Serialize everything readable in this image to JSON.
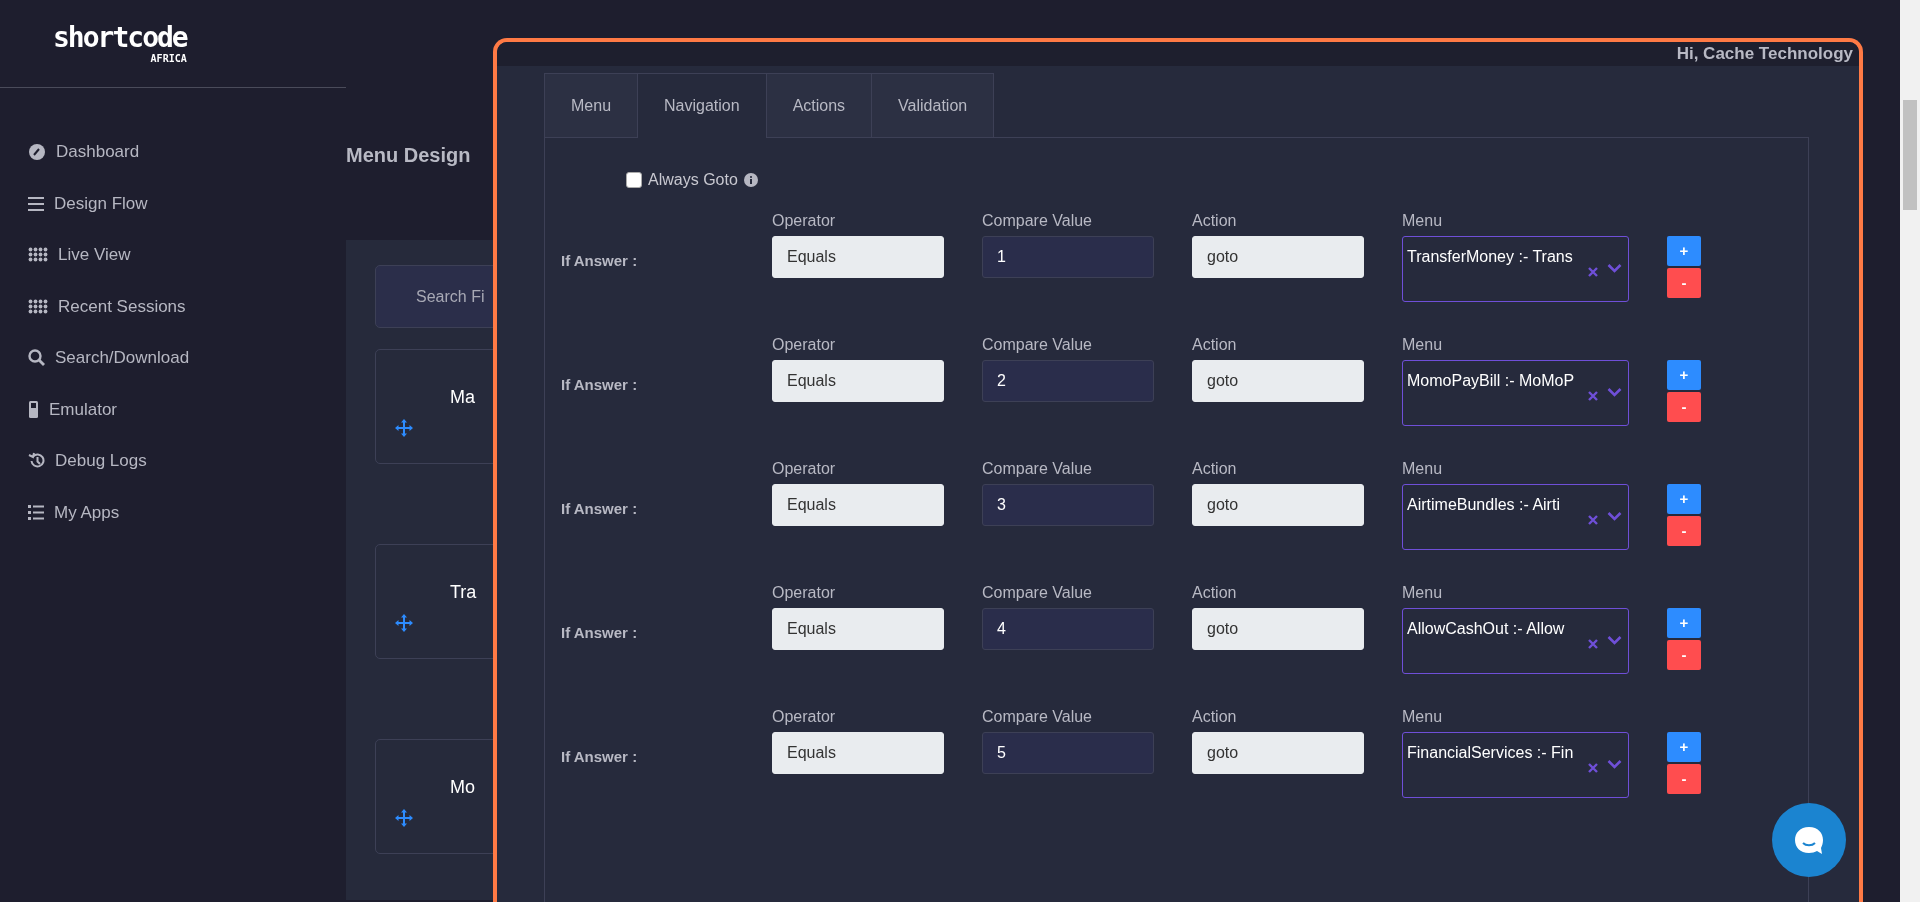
{
  "header": {
    "logo": "shortcode",
    "logo_sub": "AFRICA"
  },
  "sidebar": {
    "items": [
      {
        "label": "Dashboard"
      },
      {
        "label": "Design Flow"
      },
      {
        "label": "Live View"
      },
      {
        "label": "Recent Sessions"
      },
      {
        "label": "Search/Download"
      },
      {
        "label": "Emulator"
      },
      {
        "label": "Debug Logs"
      },
      {
        "label": "My Apps"
      }
    ]
  },
  "page": {
    "title": "Menu Design",
    "search_placeholder": "Search Fi",
    "cards": [
      {
        "title": "Ma"
      },
      {
        "title": "Tra"
      },
      {
        "title": "Mo"
      }
    ]
  },
  "modal": {
    "greeting": "Hi, Cache Technology",
    "tabs": [
      {
        "label": "Menu",
        "selected": false
      },
      {
        "label": "Navigation",
        "selected": true
      },
      {
        "label": "Actions",
        "selected": false
      },
      {
        "label": "Validation",
        "selected": false
      }
    ],
    "always_goto": {
      "label": "Always Goto",
      "checked": false
    },
    "add_label": "+",
    "remove_label": "-",
    "rules": [
      {
        "label": "If Answer :",
        "operator_label": "Operator",
        "operator": "Equals",
        "compare_label": "Compare Value",
        "compare_value": "1",
        "action_label": "Action",
        "action": "goto",
        "menu_label": "Menu",
        "menu": "TransferMoney :- Trans"
      },
      {
        "label": "If Answer :",
        "operator_label": "Operator",
        "operator": "Equals",
        "compare_label": "Compare Value",
        "compare_value": "2",
        "action_label": "Action",
        "action": "goto",
        "menu_label": "Menu",
        "menu": "MomoPayBill :- MoMoP"
      },
      {
        "label": "If Answer :",
        "operator_label": "Operator",
        "operator": "Equals",
        "compare_label": "Compare Value",
        "compare_value": "3",
        "action_label": "Action",
        "action": "goto",
        "menu_label": "Menu",
        "menu": "AirtimeBundles :- Airti"
      },
      {
        "label": "If Answer :",
        "operator_label": "Operator",
        "operator": "Equals",
        "compare_label": "Compare Value",
        "compare_value": "4",
        "action_label": "Action",
        "action": "goto",
        "menu_label": "Menu",
        "menu": "AllowCashOut :- Allow"
      },
      {
        "label": "If Answer :",
        "operator_label": "Operator",
        "operator": "Equals",
        "compare_label": "Compare Value",
        "compare_value": "5",
        "action_label": "Action",
        "action": "goto",
        "menu_label": "Menu",
        "menu": "FinancialServices :- Fin"
      }
    ]
  }
}
